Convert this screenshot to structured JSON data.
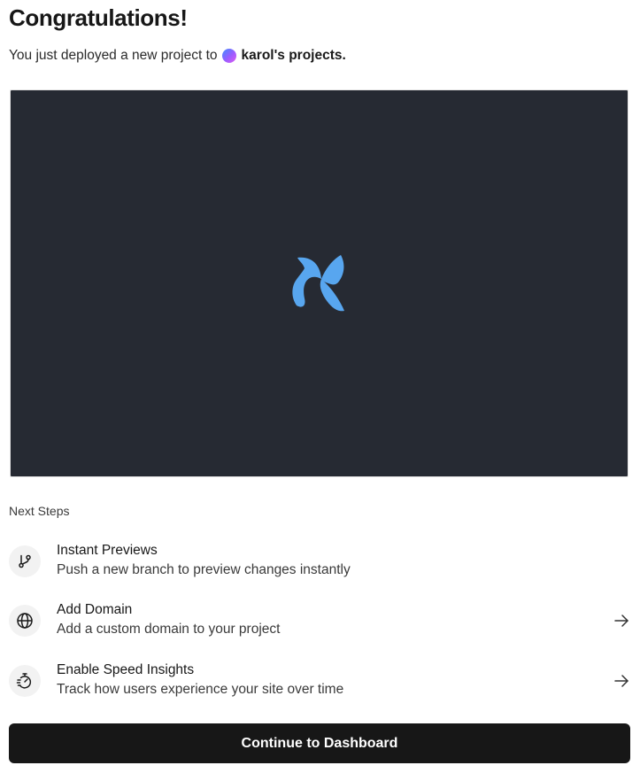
{
  "header": {
    "title": "Congratulations!",
    "subtitle_prefix": "You just deployed a new project to",
    "team_name": "karol's projects."
  },
  "preview": {
    "logo_icon": "x-logo-icon",
    "logo_color": "#58a6ef",
    "background_color": "#262a33"
  },
  "next_steps": {
    "label": "Next Steps",
    "items": [
      {
        "title": "Instant Previews",
        "description": "Push a new branch to preview changes instantly",
        "icon": "git-branch-icon",
        "has_arrow": false
      },
      {
        "title": "Add Domain",
        "description": "Add a custom domain to your project",
        "icon": "globe-icon",
        "has_arrow": true
      },
      {
        "title": "Enable Speed Insights",
        "description": "Track how users experience your site over time",
        "icon": "stopwatch-icon",
        "has_arrow": true
      }
    ]
  },
  "cta": {
    "label": "Continue to Dashboard"
  }
}
